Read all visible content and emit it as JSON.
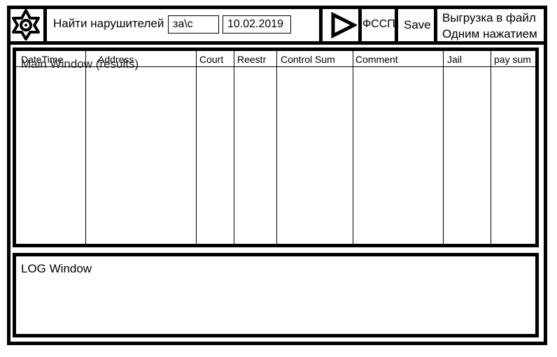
{
  "toolbar": {
    "logo_icon": "gear-star-icon",
    "find_label": "Найти нарушителей",
    "filter_value": "за\\с",
    "date_value": "10.02.2019",
    "run_icon": "play-icon",
    "fssp_label": "ФССП",
    "save_label": "Save",
    "export_line1": "Выгрузка в файл",
    "export_line2": "Одним нажатием"
  },
  "main": {
    "title": "Main Window (results)",
    "columns": [
      "DateTime",
      "Address",
      "Court",
      "Reestr",
      "Control Sum",
      "Comment",
      "Jail",
      "pay sum"
    ],
    "rows": []
  },
  "log": {
    "title": "LOG Window"
  }
}
